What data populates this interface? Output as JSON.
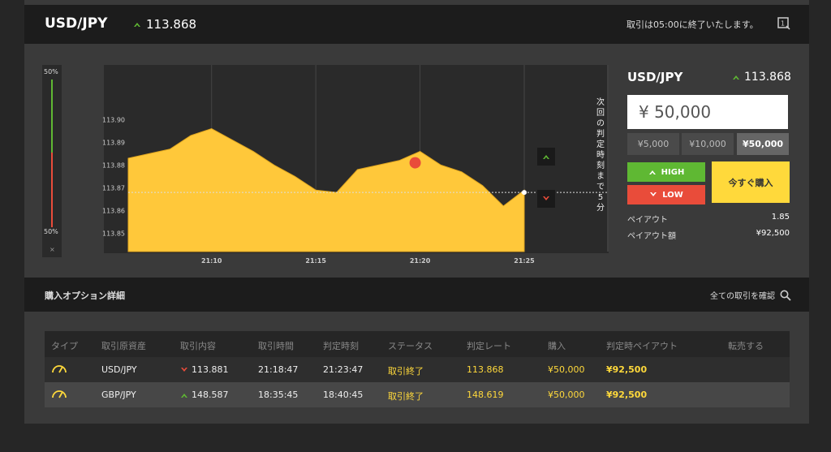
{
  "header": {
    "pair": "USD/JPY",
    "rate": "113.868",
    "expire_message": "取引は05:00に終了いたします。"
  },
  "gauge": {
    "top_label": "50%",
    "bottom_label": "50%",
    "close": "×"
  },
  "chart_data": {
    "type": "area",
    "y_ticks": [
      "113.90",
      "113.89",
      "113.88",
      "113.87",
      "113.86",
      "113.85"
    ],
    "x_ticks": [
      "21:10",
      "21:15",
      "21:20",
      "21:25"
    ],
    "ylim": [
      113.842,
      113.924
    ],
    "x": [
      "21:06",
      "21:07",
      "21:08",
      "21:09",
      "21:10",
      "21:11",
      "21:12",
      "21:13",
      "21:14",
      "21:15",
      "21:16",
      "21:17",
      "21:18",
      "21:19",
      "21:20",
      "21:21",
      "21:22",
      "21:23",
      "21:24",
      "21:25"
    ],
    "values": [
      113.883,
      113.885,
      113.887,
      113.893,
      113.896,
      113.891,
      113.886,
      113.88,
      113.875,
      113.869,
      113.868,
      113.878,
      113.88,
      113.882,
      113.886,
      113.88,
      113.877,
      113.871,
      113.862,
      113.869
    ],
    "current_rate": 113.868,
    "series_color": "#ffc83a",
    "countdown_label": "次回の判定時刻まで5分"
  },
  "side": {
    "pair": "USD/JPY",
    "rate": "113.868",
    "amount": "¥ 50,000",
    "presets": [
      {
        "label": "¥5,000",
        "selected": false
      },
      {
        "label": "¥10,000",
        "selected": false
      },
      {
        "label": "¥50,000",
        "selected": true
      }
    ],
    "high_label": "HIGH",
    "low_label": "LOW",
    "buy_label": "今すぐ購入",
    "payout_label": "ペイアウト",
    "payout_value": "1.85",
    "payout_amount_label": "ペイアウト額",
    "payout_amount_value": "¥92,500",
    "colors": {
      "high": "#5fb833",
      "low": "#e94c3a",
      "buy": "#ffd93b"
    }
  },
  "details": {
    "title": "購入オプション詳細",
    "link": "全ての取引を確認"
  },
  "table": {
    "headers": [
      "タイプ",
      "取引原資産",
      "取引内容",
      "取引時間",
      "判定時刻",
      "ステータス",
      "判定レート",
      "購入",
      "判定時ペイアウト",
      "転売する"
    ],
    "rows": [
      {
        "asset": "USD/JPY",
        "direction": "low",
        "strike": "113.881",
        "trade_time": "21:18:47",
        "expiry": "21:23:47",
        "status": "取引終了",
        "close_rate": "113.868",
        "purchase": "¥50,000",
        "payout": "¥92,500"
      },
      {
        "asset": "GBP/JPY",
        "direction": "high",
        "strike": "148.587",
        "trade_time": "18:35:45",
        "expiry": "18:40:45",
        "status": "取引終了",
        "close_rate": "148.619",
        "purchase": "¥50,000",
        "payout": "¥92,500"
      }
    ]
  }
}
